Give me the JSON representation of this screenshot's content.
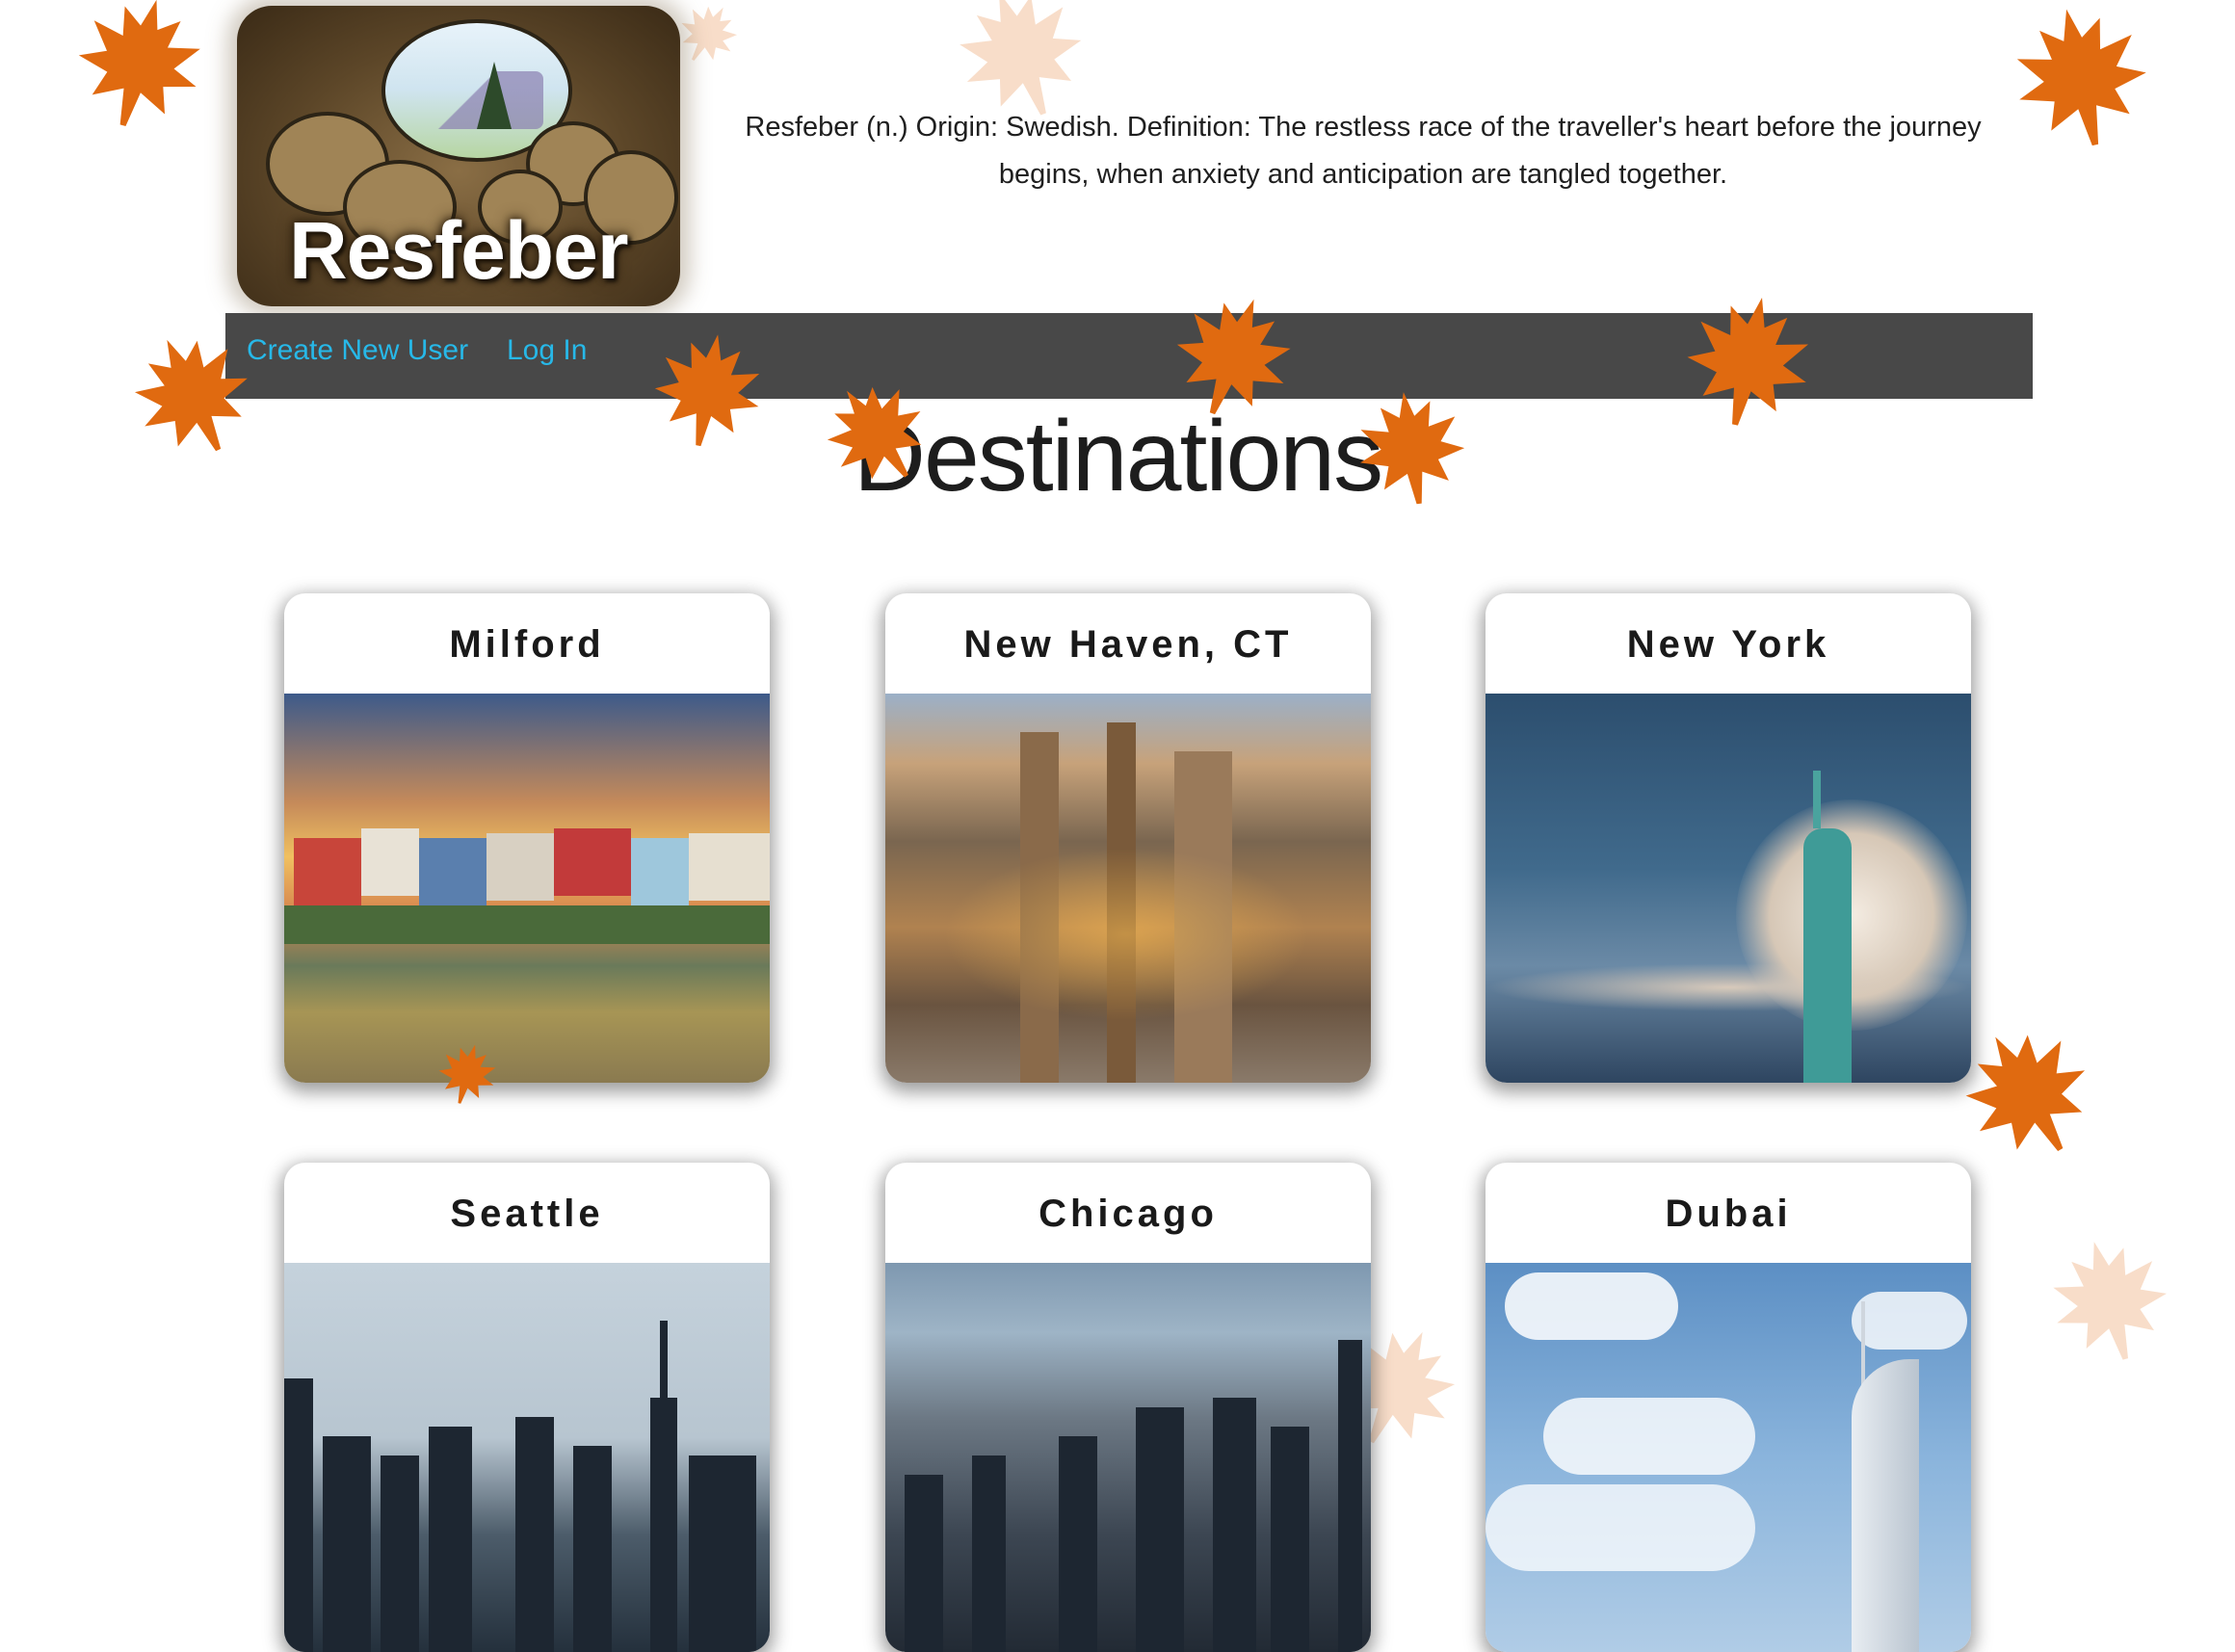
{
  "site": {
    "logo_text": "Resfeber",
    "tagline": "Resfeber (n.) Origin: Swedish. Definition: The restless race of the traveller's heart before the journey begins, when anxiety and anticipation are tangled together."
  },
  "nav": {
    "create_user": "Create New User",
    "log_in": "Log In",
    "link_color": "#27b8e8",
    "bar_color": "#484848"
  },
  "page": {
    "title": "Destinations"
  },
  "destinations": [
    {
      "name": "Milford"
    },
    {
      "name": "New Haven, CT"
    },
    {
      "name": "New York"
    },
    {
      "name": "Seattle"
    },
    {
      "name": "Chicago"
    },
    {
      "name": "Dubai"
    }
  ],
  "colors": {
    "leaf": "#e06a10",
    "leaf_dark": "#b84a08"
  }
}
